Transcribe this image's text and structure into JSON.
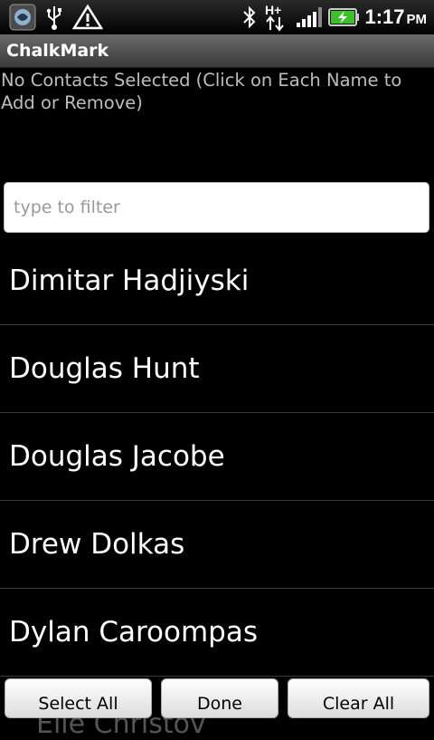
{
  "status_bar": {
    "time": "1:17",
    "ampm": "PM",
    "network": "H+",
    "icons": [
      "app-notification-icon",
      "usb-icon",
      "warning-icon",
      "bluetooth-icon",
      "network-hplus-icon",
      "signal-icon",
      "battery-charging-icon"
    ]
  },
  "app": {
    "title": "ChalkMark"
  },
  "selection_status": "No Contacts Selected (Click on Each Name to Add or Remove)",
  "filter": {
    "placeholder": "type to filter",
    "value": ""
  },
  "contacts": [
    {
      "name": "Dimitar Hadjiyski"
    },
    {
      "name": "Douglas Hunt"
    },
    {
      "name": "Douglas Jacobe"
    },
    {
      "name": "Drew Dolkas"
    },
    {
      "name": "Dylan Caroompas"
    }
  ],
  "partially_hidden_contact": "Elie Christov",
  "buttons": {
    "select_all": "Select All",
    "done": "Done",
    "clear_all": "Clear All"
  }
}
